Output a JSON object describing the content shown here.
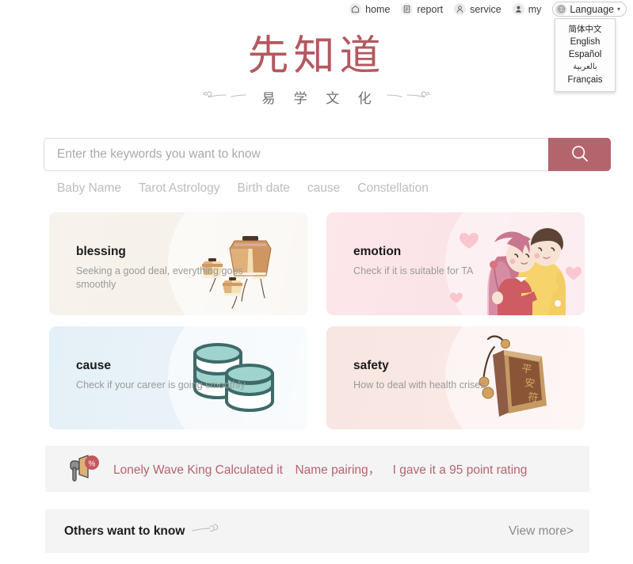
{
  "topnav": {
    "items": [
      {
        "label": "home",
        "icon": "home-icon"
      },
      {
        "label": "report",
        "icon": "report-icon"
      },
      {
        "label": "service",
        "icon": "service-icon"
      },
      {
        "label": "my",
        "icon": "user-icon"
      }
    ],
    "language_button": {
      "label": "Language",
      "icon": "globe-icon",
      "caret": "▾"
    },
    "language_menu": {
      "options": [
        "简体中文",
        "English",
        "Español",
        "بالعربية",
        "Français"
      ]
    }
  },
  "brand": {
    "title": "先知道",
    "subtitle": "易 学 文 化"
  },
  "search": {
    "placeholder": "Enter the keywords you want to know",
    "value": "",
    "button_icon": "search-icon",
    "hot_tags": [
      "Baby Name",
      "Tarot Astrology",
      "Birth date",
      "cause",
      "Constellation"
    ]
  },
  "cards": [
    {
      "title": "blessing",
      "desc": "Seeking a good deal, everything goes smoothly",
      "art": "sky-lanterns-illustration",
      "bg": "#f6f1e9"
    },
    {
      "title": "emotion",
      "desc": "Check if it is suitable for TA",
      "art": "couple-hug-illustration",
      "bg": "#fbe3e7"
    },
    {
      "title": "cause",
      "desc": "Check if your career is going smoothly",
      "art": "coin-stacks-illustration",
      "bg": "#eaf3f8"
    },
    {
      "title": "safety",
      "desc": "How to deal with health crises",
      "art": "amulet-charm-illustration",
      "bg": "#f9e8e4"
    }
  ],
  "notice": {
    "icon": "megaphone-icon",
    "badge": "%",
    "text": "Lonely Wave King Calculated it Name pairing， I gave it a 95 point rating"
  },
  "others": {
    "title": "Others want to know",
    "decor_icon": "cloud-icon",
    "view_more": "View more>"
  },
  "colors": {
    "accent": "#b4646d",
    "brand_title": "#b4585f",
    "panel_bg": "#f4f4f4",
    "muted_text": "#9a9a9a"
  }
}
